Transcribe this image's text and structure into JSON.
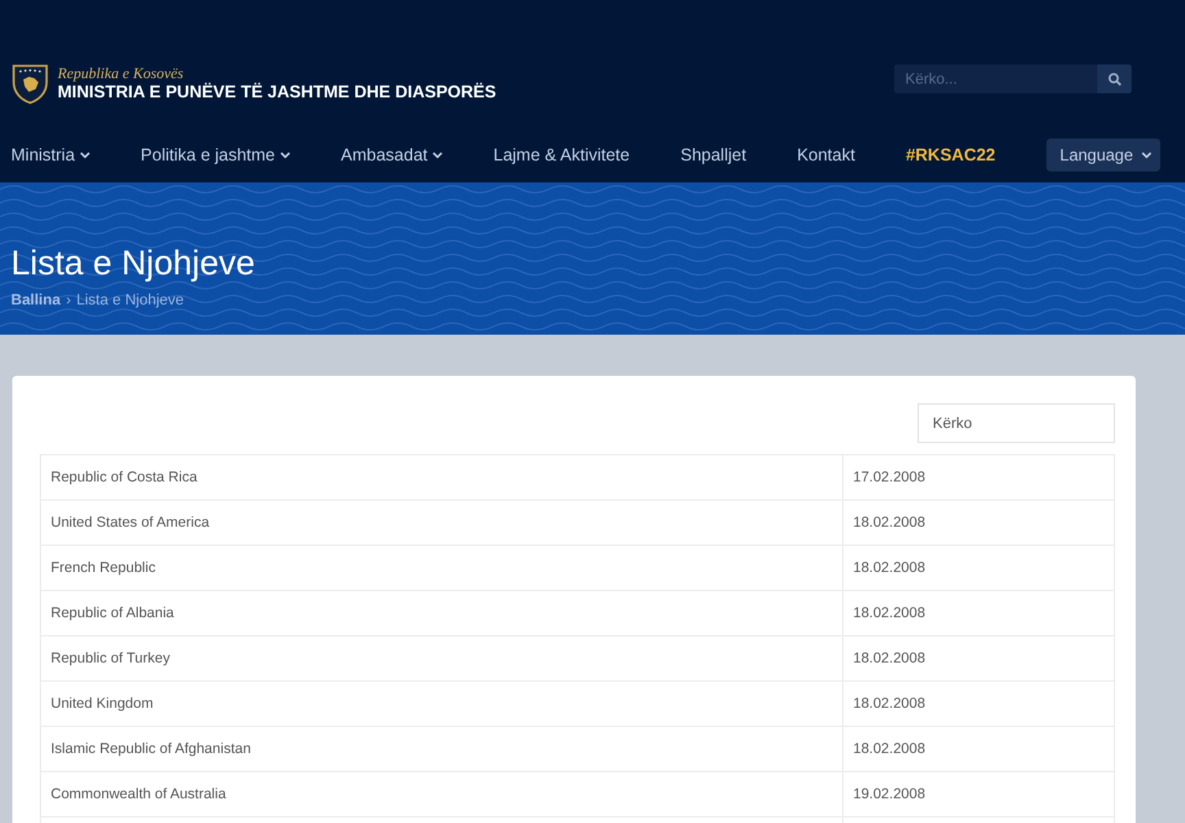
{
  "header": {
    "emblem_caption": "Republika e Kosovës",
    "ministry": "MINISTRIA E PUNËVE TË JASHTME DHE DIASPORËS",
    "search": {
      "placeholder": "Kërko..."
    }
  },
  "nav": [
    {
      "label": "Ministria",
      "dropdown": true,
      "highlight": false
    },
    {
      "label": "Politika e jashtme",
      "dropdown": true,
      "highlight": false
    },
    {
      "label": "Ambasadat",
      "dropdown": true,
      "highlight": false
    },
    {
      "label": "Lajme & Aktivitete",
      "dropdown": false,
      "highlight": false
    },
    {
      "label": "Shpalljet",
      "dropdown": false,
      "highlight": false
    },
    {
      "label": "Kontakt",
      "dropdown": false,
      "highlight": false
    },
    {
      "label": "#RKSAC22",
      "dropdown": false,
      "highlight": true
    }
  ],
  "language": "Language",
  "page_title": "Lista e Njohjeve",
  "breadcrumb": {
    "home": "Ballina",
    "separator": "›",
    "current": "Lista e Njohjeve"
  },
  "table": {
    "search": {
      "placeholder": "Kërko"
    },
    "rows": [
      {
        "country": "Republic of Costa Rica",
        "date": "17.02.2008"
      },
      {
        "country": "United States of America",
        "date": "18.02.2008"
      },
      {
        "country": "French Republic",
        "date": "18.02.2008"
      },
      {
        "country": "Republic of Albania",
        "date": "18.02.2008"
      },
      {
        "country": "Republic of Turkey",
        "date": "18.02.2008"
      },
      {
        "country": "United Kingdom",
        "date": "18.02.2008"
      },
      {
        "country": "Islamic Republic of Afghanistan",
        "date": "18.02.2008"
      },
      {
        "country": "Commonwealth of Australia",
        "date": "19.02.2008"
      }
    ]
  }
}
